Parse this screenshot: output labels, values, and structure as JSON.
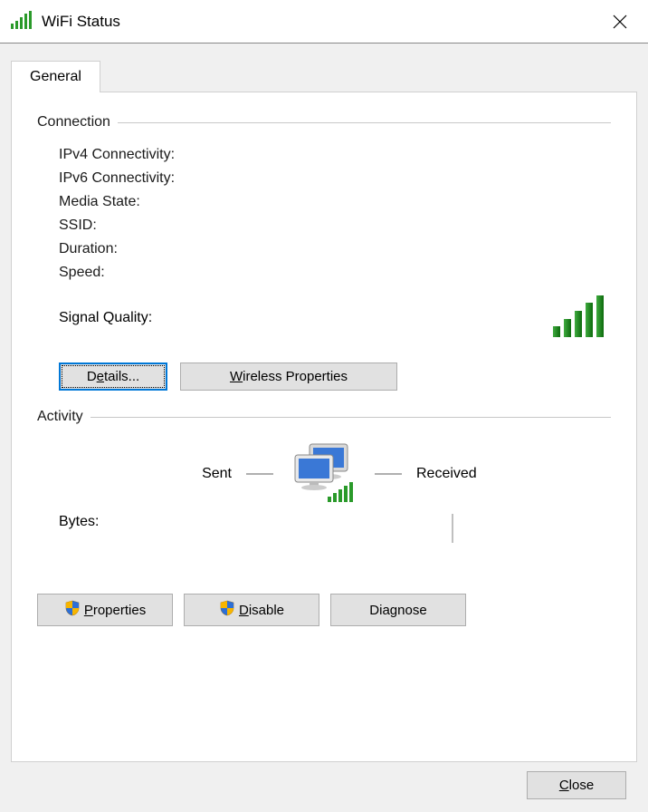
{
  "titlebar": {
    "title": "WiFi Status"
  },
  "tabs": {
    "general": "General"
  },
  "connection": {
    "title": "Connection",
    "ipv4_label": "IPv4 Connectivity:",
    "ipv4_value": "",
    "ipv6_label": "IPv6 Connectivity:",
    "ipv6_value": "",
    "media_state_label": "Media State:",
    "media_state_value": "",
    "ssid_label": "SSID:",
    "ssid_value": "",
    "duration_label": "Duration:",
    "duration_value": "",
    "speed_label": "Speed:",
    "speed_value": "",
    "signal_quality_label": "Signal Quality:"
  },
  "buttons": {
    "details": "Details...",
    "details_u": "e",
    "wireless_props": "Wireless Properties",
    "wireless_props_u": "W",
    "properties": "Properties",
    "properties_u": "P",
    "disable": "Disable",
    "disable_u": "D",
    "diagnose": "Diagnose",
    "close": "Close",
    "close_u": "C"
  },
  "activity": {
    "title": "Activity",
    "sent_label": "Sent",
    "received_label": "Received",
    "bytes_label": "Bytes:",
    "bytes_sent": "",
    "bytes_received": ""
  }
}
